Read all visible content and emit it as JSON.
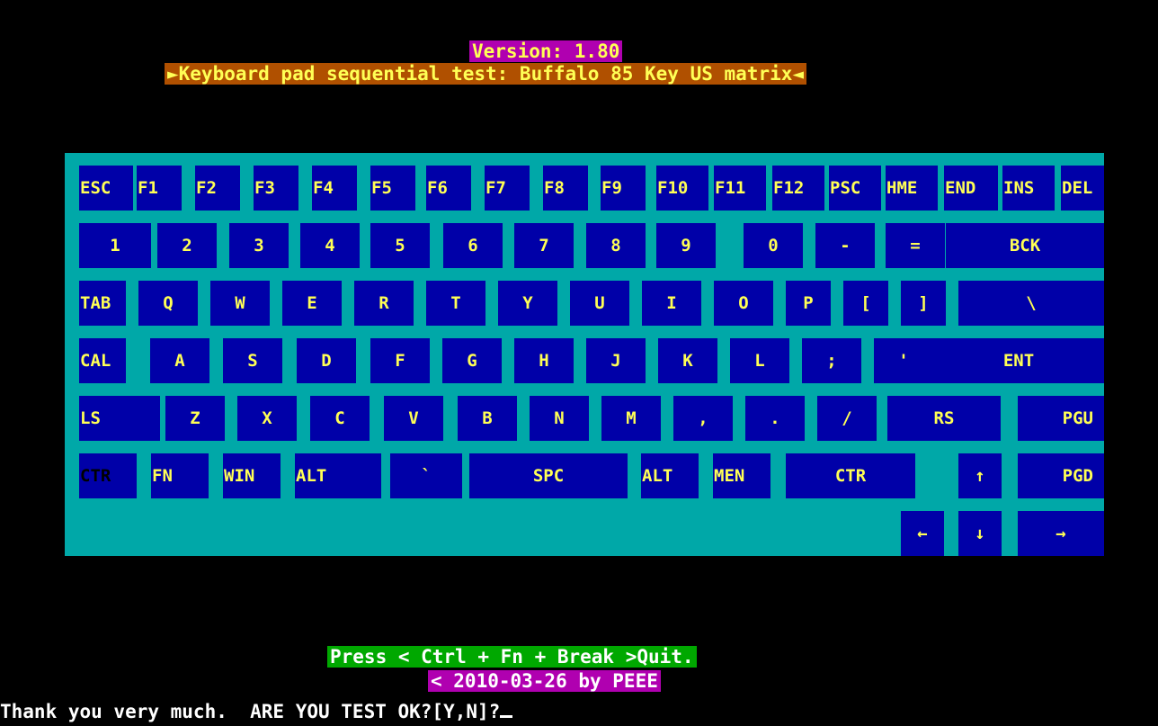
{
  "header": {
    "version": "Version: 1.80",
    "title": "►Keyboard pad sequential test: Buffalo 85 Key US matrix◄"
  },
  "keyboard": {
    "row1": [
      "ESC",
      "F1",
      "F2",
      "F3",
      "F4",
      "F5",
      "F6",
      "F7",
      "F8",
      "F9",
      "F10",
      "F11",
      "F12",
      "PSC",
      "HME",
      "END",
      "INS",
      "DEL"
    ],
    "row2": [
      "1",
      "2",
      "3",
      "4",
      "5",
      "6",
      "7",
      "8",
      "9",
      "0",
      "-",
      "=",
      "BCK"
    ],
    "row3": [
      "TAB",
      "Q",
      "W",
      "E",
      "R",
      "T",
      "Y",
      "U",
      "I",
      "O",
      "P",
      "[",
      "]",
      "\\"
    ],
    "row4": [
      "CAL",
      "A",
      "S",
      "D",
      "F",
      "G",
      "H",
      "J",
      "K",
      "L",
      ";",
      "'",
      "ENT"
    ],
    "row5": [
      "LS",
      "Z",
      "X",
      "C",
      "V",
      "B",
      "N",
      "M",
      ",",
      ".",
      "/",
      "RS",
      "PGU"
    ],
    "row6": [
      "CTR",
      "FN",
      "WIN",
      "ALT",
      "`",
      "SPC",
      "ALT",
      "MEN",
      "CTR",
      "↑",
      "PGD"
    ],
    "row7": [
      "←",
      "↓",
      "→"
    ]
  },
  "footer": {
    "quit": "Press < Ctrl + Fn + Break >Quit.",
    "date": "< 2010-03-26 by PEEE",
    "prompt": "Thank you very much.  ARE YOU TEST OK?[Y,N]?"
  },
  "colors": {
    "background": "#000000",
    "board": "#00a8a8",
    "key": "#0000a8",
    "key_text": "#ffff55"
  }
}
